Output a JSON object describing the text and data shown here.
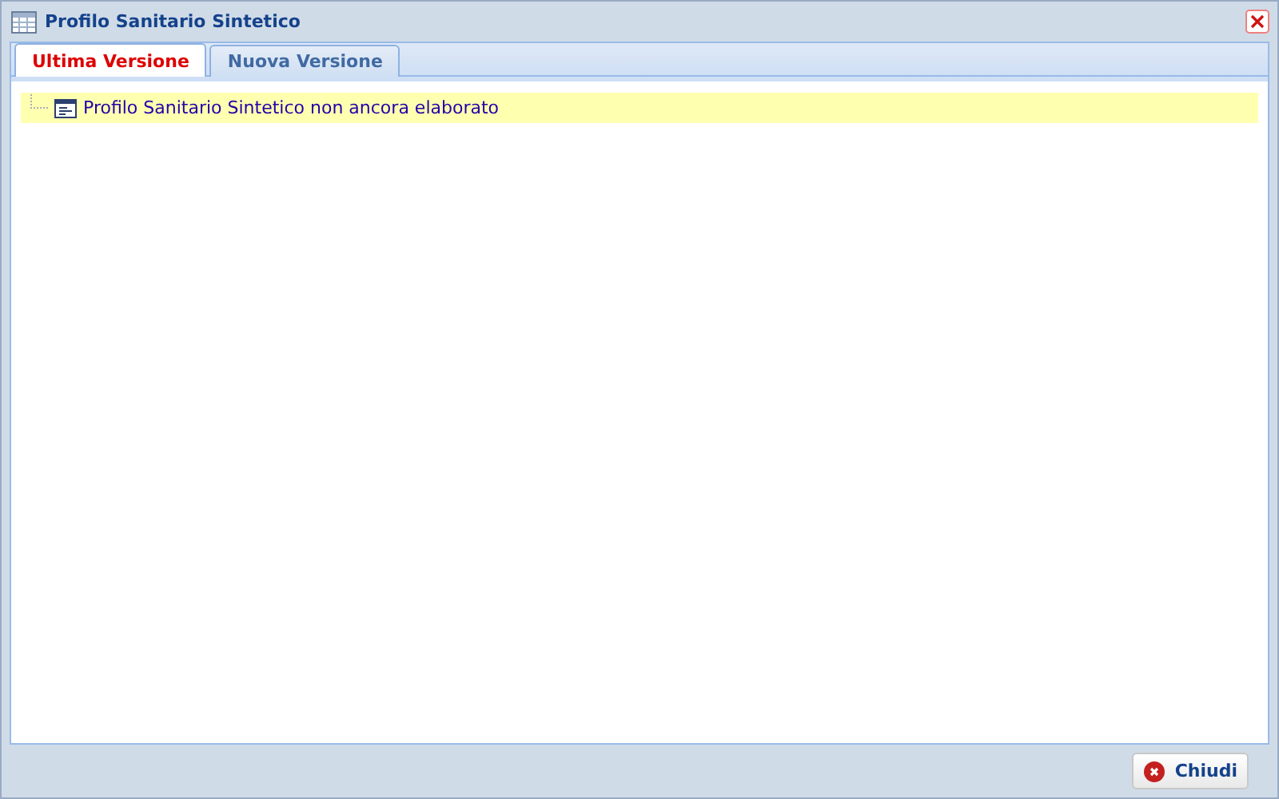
{
  "window": {
    "title": "Profilo Sanitario Sintetico"
  },
  "tabs": [
    {
      "label": "Ultima Versione",
      "selected": true
    },
    {
      "label": "Nuova Versione",
      "selected": false
    }
  ],
  "tree": [
    {
      "label": "Profilo Sanitario Sintetico non ancora elaborato",
      "selected": true
    }
  ],
  "buttons": [
    {
      "label": "Chiudi"
    }
  ]
}
